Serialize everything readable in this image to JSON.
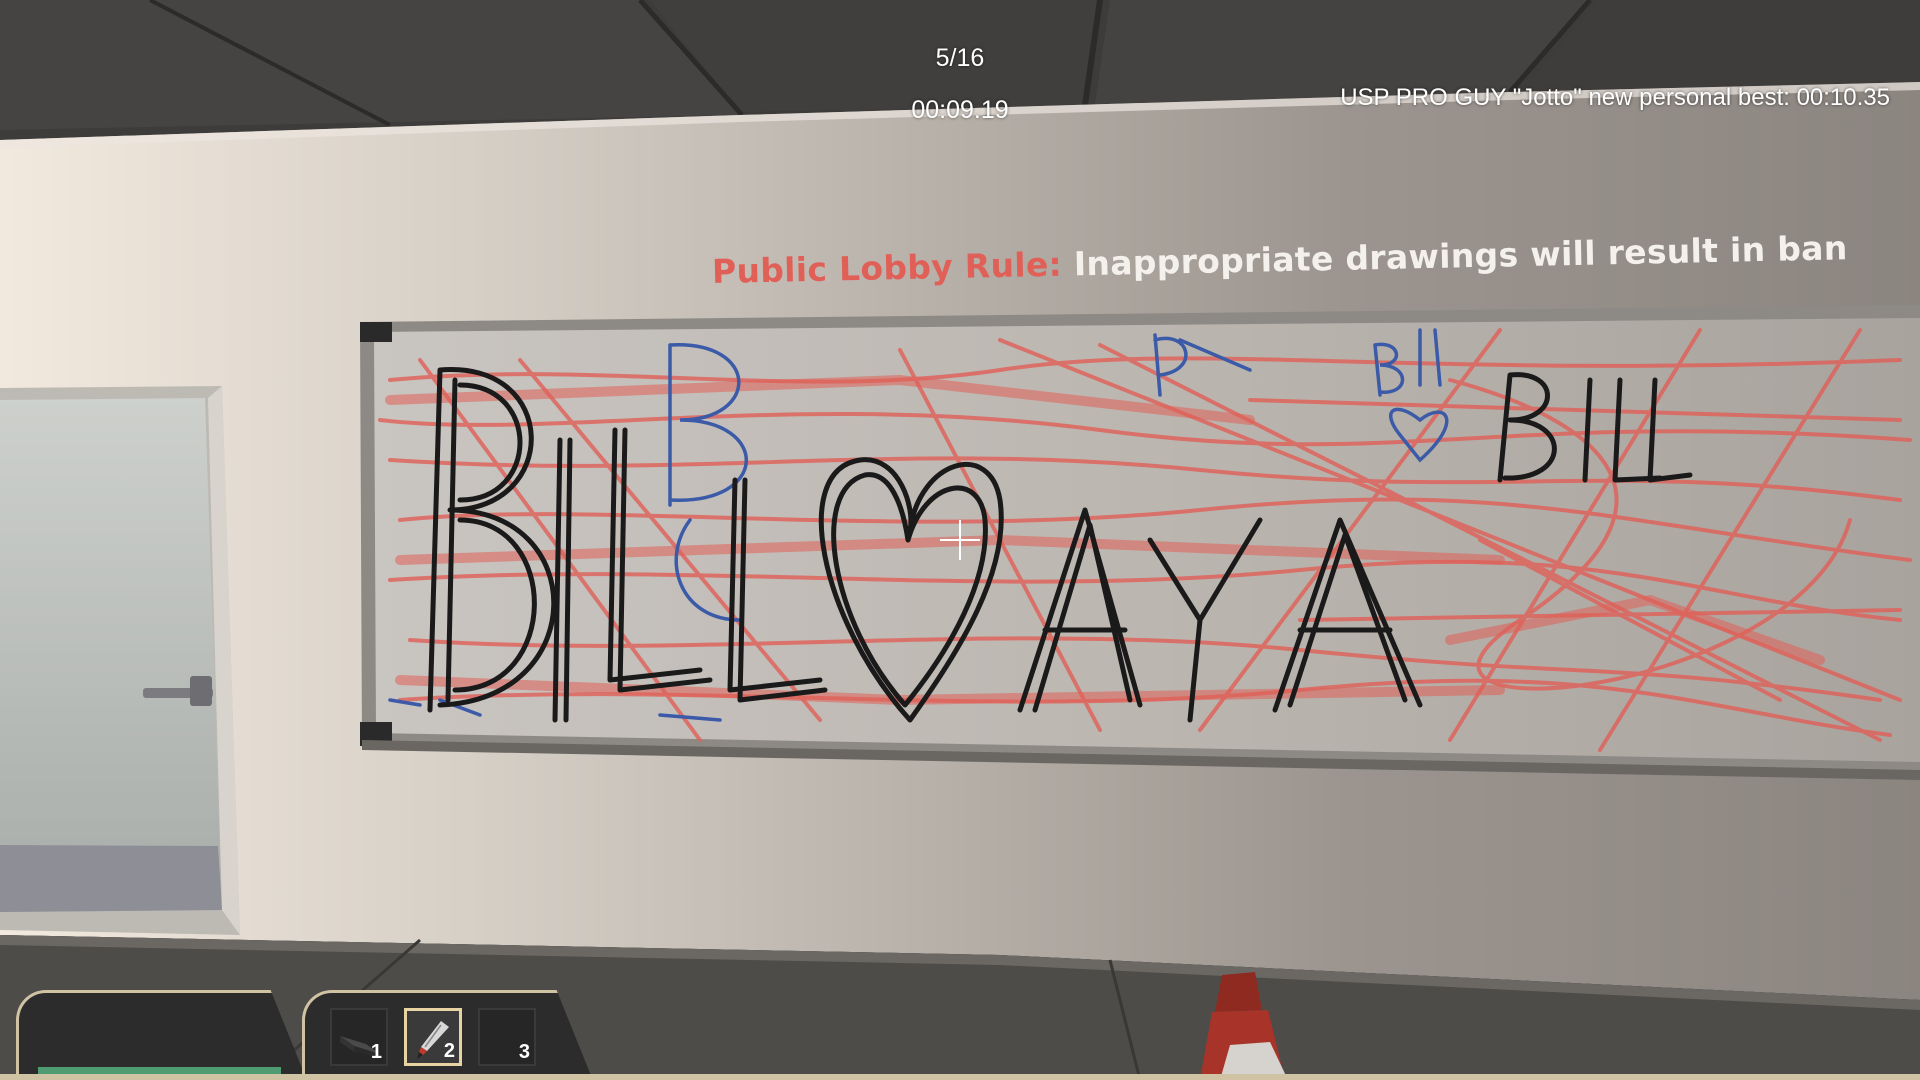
{
  "hud": {
    "round_progress": "5/16",
    "timer": "00:09.19",
    "notification": "USP PRO GUY \"Jotto\" new personal best: 00:10.35"
  },
  "banner": {
    "label": "Public Lobby Rule:",
    "text": "Inappropriate drawings will result in ban"
  },
  "player": {
    "health_fraction": 1.0
  },
  "inventory": {
    "selected_slot": 2,
    "slots": [
      {
        "number": "1",
        "icon": "eraser-icon"
      },
      {
        "number": "2",
        "icon": "marker-icon"
      },
      {
        "number": "3",
        "icon": ""
      }
    ]
  },
  "colors": {
    "rule_label": "#e06058",
    "health_bar": "#4f9b72",
    "panel_border": "#cfc3a4",
    "marker_red": "#e06058",
    "marker_black": "#1a1a1a",
    "marker_blue": "#3b5aa8"
  }
}
